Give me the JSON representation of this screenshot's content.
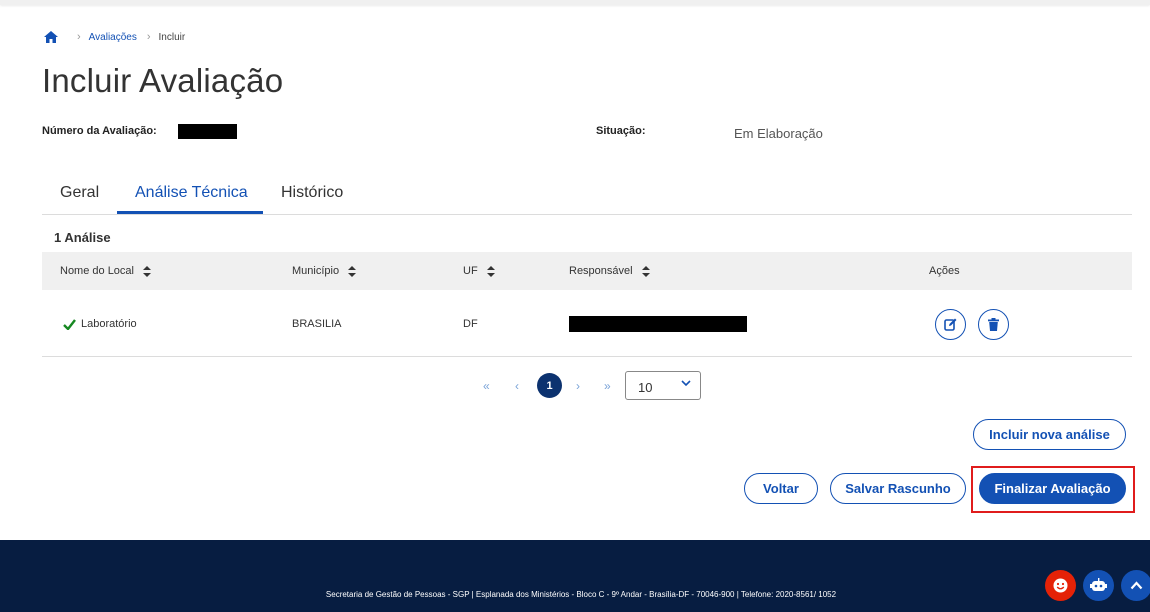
{
  "breadcrumb": {
    "home_icon": "home-icon",
    "items": [
      "Avaliações",
      "Incluir"
    ]
  },
  "page": {
    "title": "Incluir Avaliação"
  },
  "meta": {
    "number_label": "Número da Avaliação:",
    "status_label": "Situação:",
    "status_value": "Em Elaboração"
  },
  "tabs": [
    {
      "label": "Geral",
      "active": false
    },
    {
      "label": "Análise Técnica",
      "active": true
    },
    {
      "label": "Histórico",
      "active": false
    }
  ],
  "table": {
    "count_label": "1 Análise",
    "columns": [
      "Nome do Local",
      "Município",
      "UF",
      "Responsável",
      "Ações"
    ],
    "rows": [
      {
        "local": "Laboratório",
        "municipio": "BRASILIA",
        "uf": "DF"
      }
    ]
  },
  "pagination": {
    "first": "«",
    "prev": "‹",
    "current_page": "1",
    "next": "›",
    "last": "»",
    "page_size": "10"
  },
  "actions": {
    "add_label": "Incluir nova análise",
    "back_label": "Voltar",
    "draft_label": "Salvar Rascunho",
    "finish_label": "Finalizar Avaliação"
  },
  "footer": {
    "text": "Secretaria de Gestão de Pessoas - SGP | Esplanada dos Ministérios - Bloco C - 9º Andar - Brasília-DF - 70046-900 | Telefone: 2020-8561/ 1052"
  },
  "colors": {
    "primary": "#1351b4",
    "footer_bg": "#071d41",
    "highlight": "#e01c1c",
    "success": "#168821"
  }
}
